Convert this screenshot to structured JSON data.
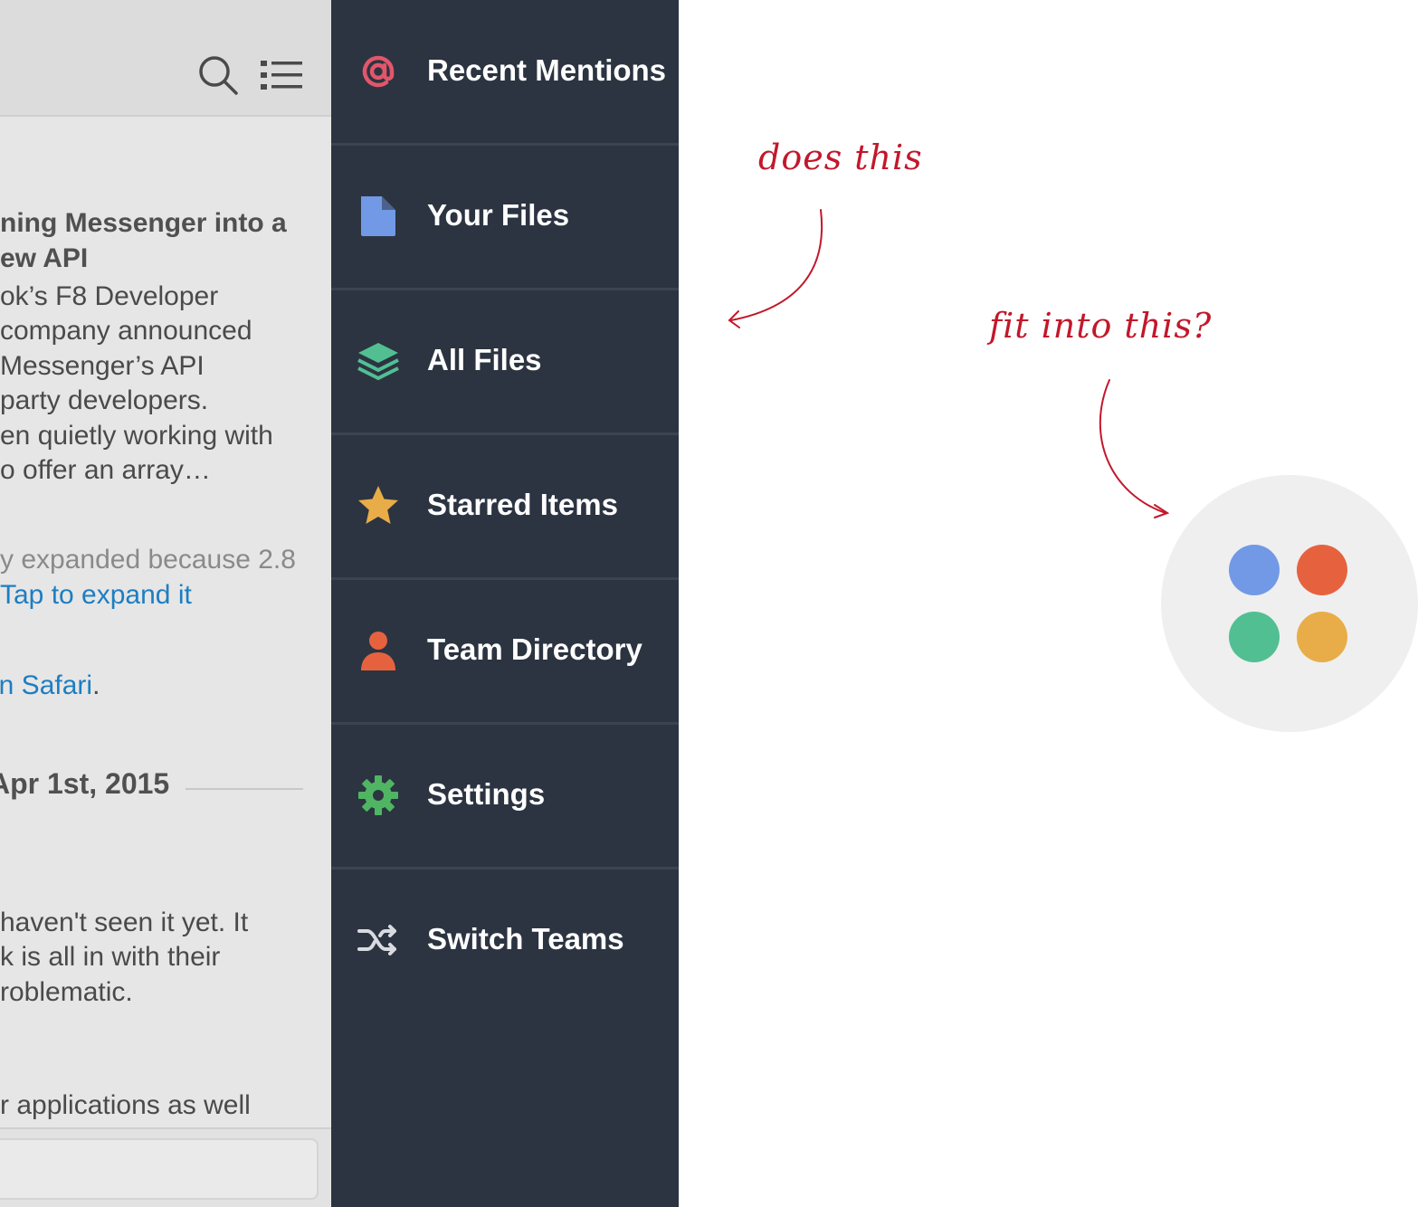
{
  "chat": {
    "message_lines": [
      "ning Messenger into a",
      "ew API",
      "ok’s F8 Developer",
      "company announced",
      "Messenger’s API",
      " party developers.",
      "en quietly working with",
      "o offer an array…",
      "y expanded because 2.8",
      "Tap to expand it",
      "in Safari",
      ".",
      "Apr 1st, 2015",
      " haven't seen it yet. It",
      "k is all in with their",
      "roblematic.",
      "r applications as well"
    ]
  },
  "menu": {
    "items": [
      {
        "label": "Recent Mentions",
        "icon": "at-icon"
      },
      {
        "label": "Your Files",
        "icon": "file-icon"
      },
      {
        "label": "All Files",
        "icon": "layers-icon"
      },
      {
        "label": "Starred Items",
        "icon": "star-icon"
      },
      {
        "label": "Team Directory",
        "icon": "person-icon"
      },
      {
        "label": "Settings",
        "icon": "gear-icon"
      },
      {
        "label": "Switch Teams",
        "icon": "shuffle-icon"
      }
    ]
  },
  "annotations": {
    "note_1": "does this",
    "note_2": "fit into this?"
  },
  "colors": {
    "menu_bg": "#2c3441",
    "chat_bg": "#e6e6e6",
    "link": "#1d7ec2",
    "annotation": "#c2182b",
    "dot_blue": "#7199e6",
    "dot_red": "#e6623f",
    "dot_green": "#52bf93",
    "dot_yellow": "#e8ad48"
  }
}
